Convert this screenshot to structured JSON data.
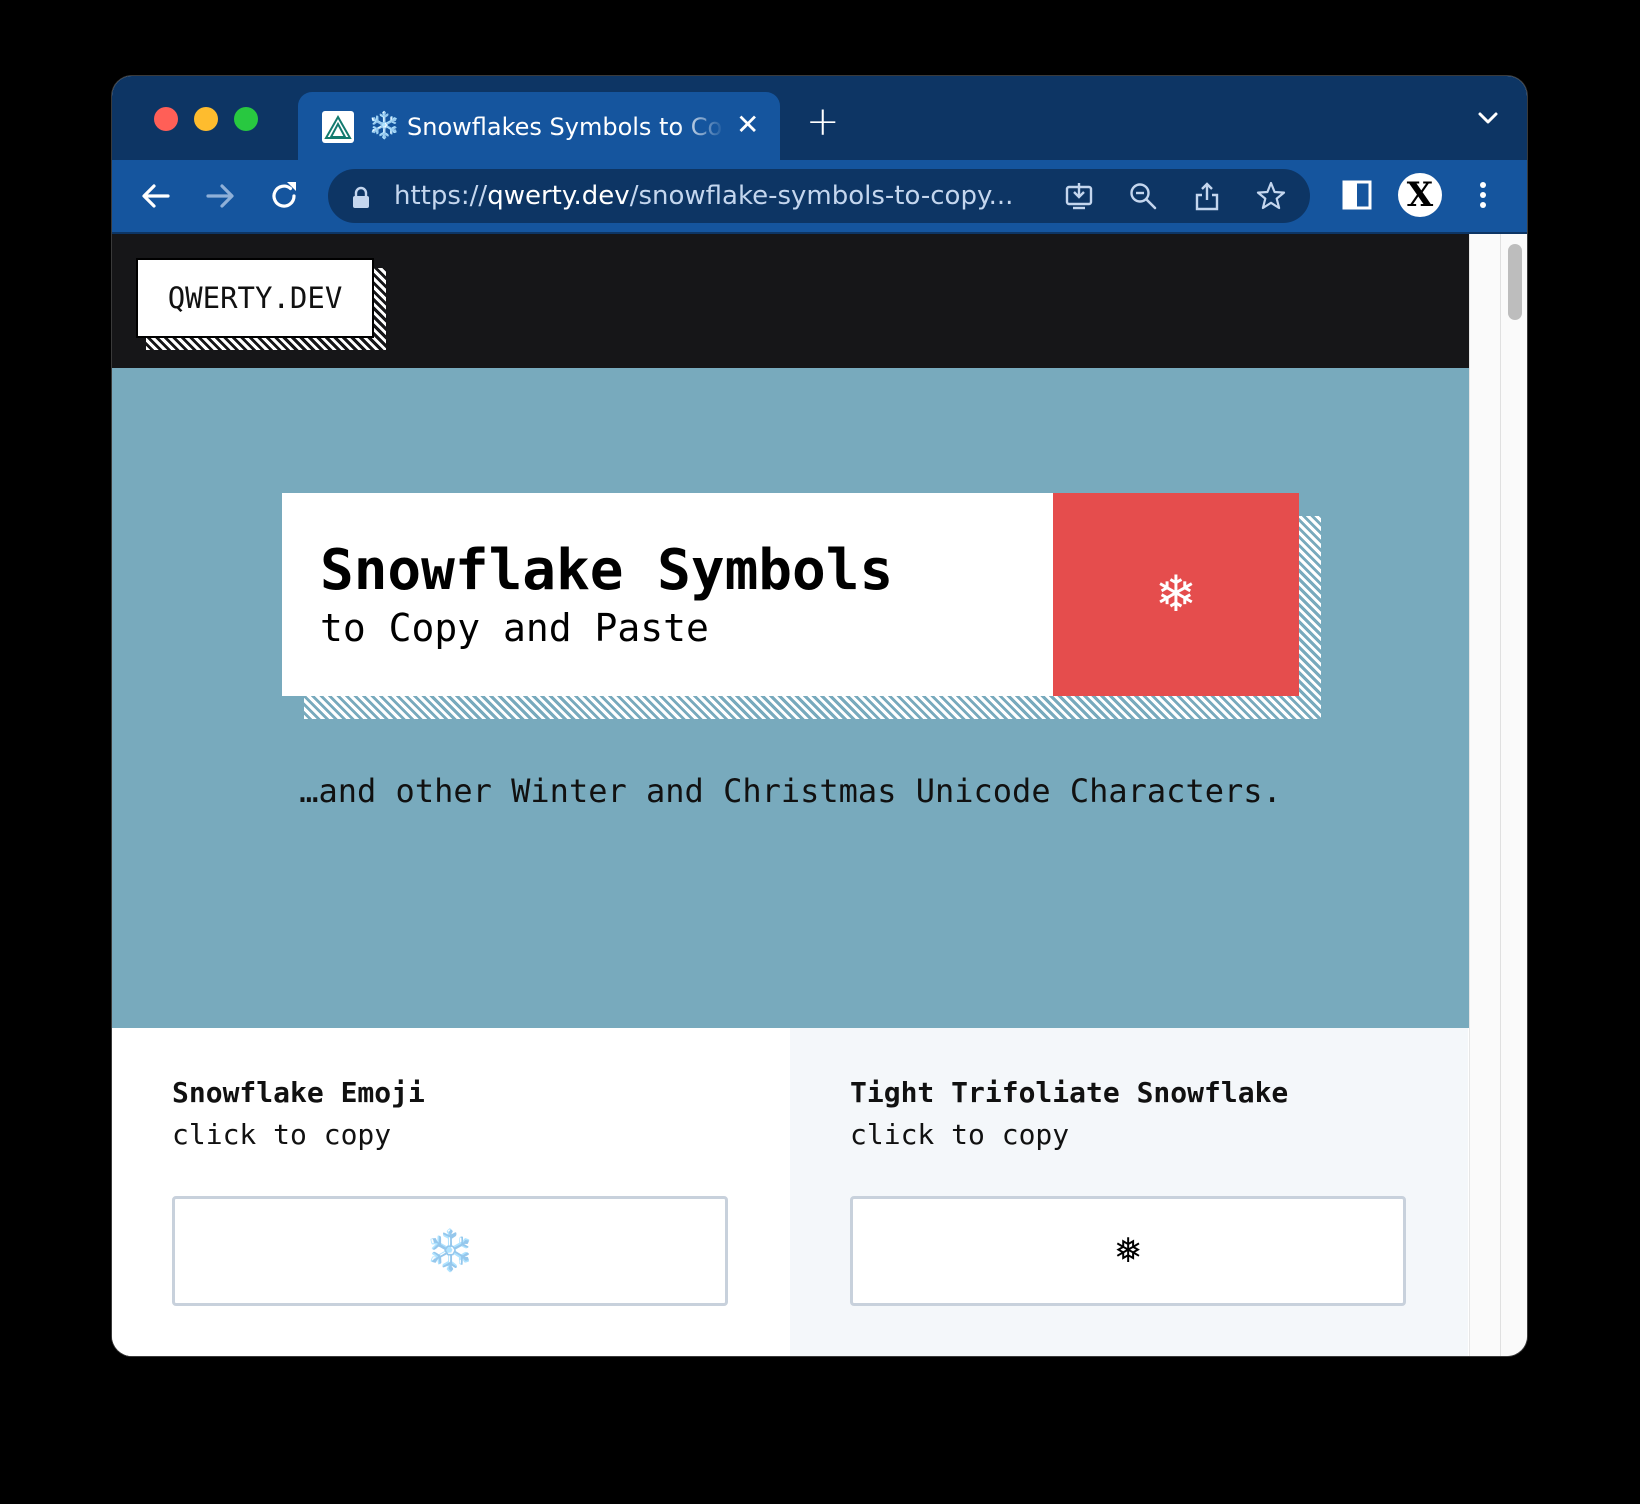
{
  "browser": {
    "tab_title": "Snowflakes Symbols to Copy and Paste",
    "tab_emoji": "❄️",
    "url_scheme": "https://",
    "url_host": "qwerty.dev",
    "url_path": "/snowflake-symbols-to-copy...",
    "profile_initial": "X",
    "icons": [
      "back-arrow-icon",
      "forward-arrow-icon",
      "reload-icon",
      "lock-icon",
      "install-icon",
      "zoom-icon",
      "share-icon",
      "star-icon",
      "sidebar-icon",
      "menu-icon",
      "close-icon",
      "plus-icon",
      "chevron-down-icon"
    ]
  },
  "site": {
    "logo": "QWERTY.DEV"
  },
  "hero": {
    "title": "Snowflake Symbols",
    "subtitle": "to Copy and Paste",
    "banner_symbol": "❄",
    "description": "…and other Winter and Christmas Unicode Characters."
  },
  "cards": [
    {
      "title": "Snowflake Emoji",
      "subtitle": "click to copy",
      "symbol": "❄️"
    },
    {
      "title": "Tight Trifoliate Snowflake",
      "subtitle": "click to copy",
      "symbol": "❅"
    }
  ],
  "colors": {
    "tab_bar": "#0d3564",
    "toolbar": "#15559e",
    "hero_bg": "#78aabd",
    "banner_red": "#e54d4d",
    "header_bg": "#161618"
  }
}
